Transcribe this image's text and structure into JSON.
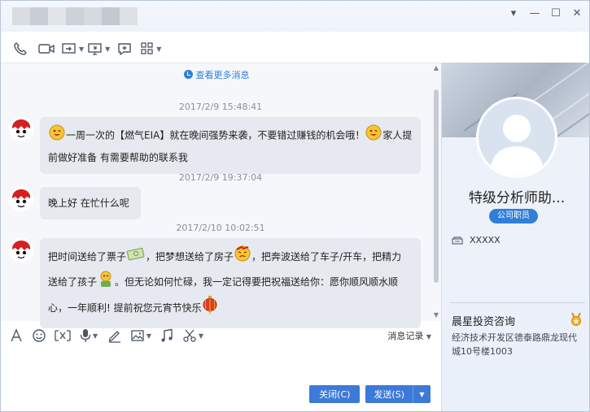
{
  "window": {
    "title_blur_colors": [
      "#d9dde3",
      "#c9ced6",
      "#e2e5ea",
      "#cdd2d9",
      "#d6dadf",
      "#c4c9d1",
      "#dde1e6"
    ],
    "controls": {
      "menu": "▾",
      "minimize": "—",
      "maximize": "☐",
      "close": "✕"
    }
  },
  "toolbar": {
    "icons": [
      "phone-icon",
      "video-icon",
      "screen-share-icon",
      "remote-desktop-icon",
      "add-chat-icon",
      "apps-grid-icon"
    ]
  },
  "chat": {
    "more_messages": "查看更多消息",
    "messages": [
      {
        "timestamp": "2017/2/9 15:48:41",
        "lines": [
          {
            "pre": "",
            "text": "一周一次的【燃气EIA】就在晚间强势来袭，不要错过赚钱的机会哦！",
            "post": "家人提"
          },
          {
            "pre": "",
            "text": "前做好准备 有需要帮助的联系我",
            "post": ""
          }
        ]
      },
      {
        "timestamp": "2017/2/9 19:37:04",
        "text": "晚上好  在忙什么呢"
      },
      {
        "timestamp": "2017/2/10 10:02:51",
        "lines": [
          {
            "a": "把时间送给了票子",
            "b": "，把梦想送给了房子",
            "c": "，把奔波送给了车子/开车，把精力"
          },
          {
            "a": "送给了孩子",
            "b": "。但无论如何忙碌，我一定记得要把祝福送给你：愿你顺风顺水顺"
          },
          {
            "a": "心，一年顺利! 提前祝您元宵节快乐"
          }
        ]
      }
    ]
  },
  "input_toolbar": {
    "icons": [
      "font-icon",
      "emoji-icon",
      "screenshot-icon",
      "voice-icon",
      "handwrite-icon",
      "image-icon",
      "music-icon",
      "cut-icon"
    ],
    "message_record": "消息记录"
  },
  "send": {
    "close_label": "关闭(C)",
    "send_label": "发送(S)"
  },
  "profile": {
    "name": "特级分析师助...",
    "role": "公司职员",
    "phone": "XXXXX",
    "company": "晨星投资咨询",
    "address": "经济技术开发区德泰路鼎龙现代城10号楼1003"
  },
  "colors": {
    "accent": "#2f7fd9",
    "button": "#3d7ad8",
    "bubble": "#e6e9ef"
  }
}
